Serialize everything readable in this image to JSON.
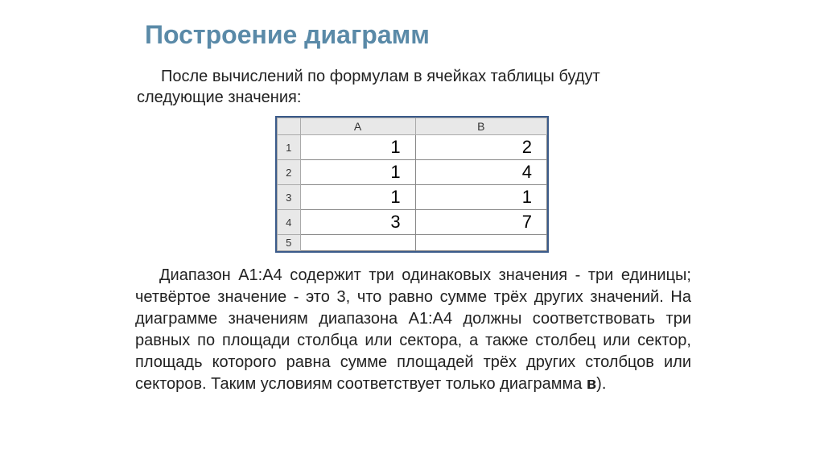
{
  "title": "Построение диаграмм",
  "intro": "После вычислений по формулам в ячейках таблицы будут следующие значения:",
  "spreadsheet": {
    "columns": [
      "A",
      "B"
    ],
    "rows": [
      {
        "num": "1",
        "a": "1",
        "b": "2"
      },
      {
        "num": "2",
        "a": "1",
        "b": "4"
      },
      {
        "num": "3",
        "a": "1",
        "b": "1"
      },
      {
        "num": "4",
        "a": "3",
        "b": "7"
      },
      {
        "num": "5",
        "a": "",
        "b": ""
      }
    ]
  },
  "body_part1": "Диапазон A1:A4 содержит три одинаковых значения - три единицы; четвёртое значение - это 3, что равно сумме трёх других значений. На диаграмме значениям диапазона A1:A4 должны соответствовать три равных по площади столбца или сектора, а также столбец или сектор, площадь которого равна сумме площадей трёх других столбцов или секторов. Таким условиям соответствует только диаграмма ",
  "body_bold": "в",
  "body_part2": ")."
}
